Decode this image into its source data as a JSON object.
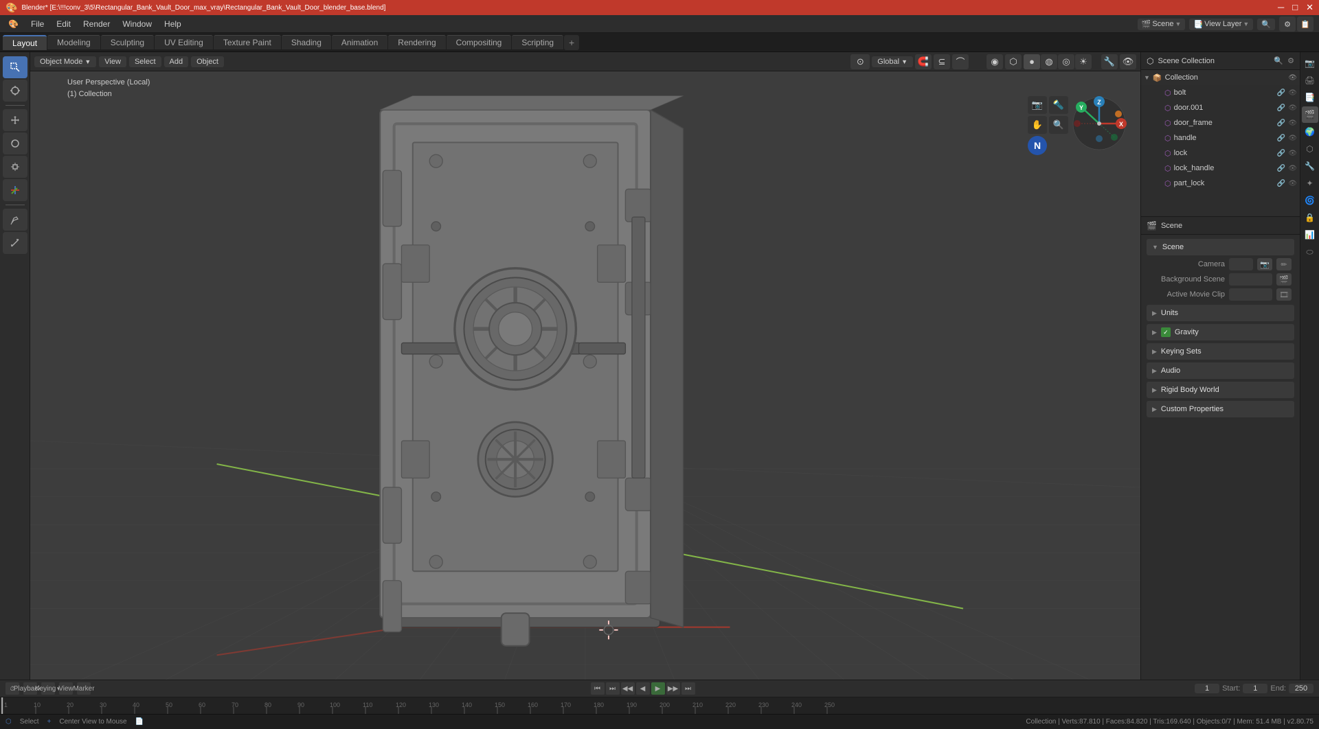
{
  "titleBar": {
    "title": "Blender* [E:\\!!!conv_3\\5\\Rectangular_Bank_Vault_Door_max_vray\\Rectangular_Bank_Vault_Door_blender_base.blend]",
    "close": "✕",
    "minimize": "─",
    "maximize": "□"
  },
  "menuBar": {
    "items": [
      "Blender",
      "File",
      "Edit",
      "Render",
      "Window",
      "Help"
    ]
  },
  "workspaceTabs": {
    "tabs": [
      "Layout",
      "Modeling",
      "Sculpting",
      "UV Editing",
      "Texture Paint",
      "Shading",
      "Animation",
      "Rendering",
      "Compositing",
      "Scripting"
    ],
    "activeTab": "Layout",
    "addLabel": "+"
  },
  "viewport": {
    "modeLabel": "Object Mode",
    "viewLabel": "View",
    "selectLabel": "Select",
    "addLabel": "Add",
    "objectLabel": "Object",
    "globalLabel": "Global",
    "infoLine1": "User Perspective (Local)",
    "infoLine2": "(1) Collection"
  },
  "outliner": {
    "title": "Scene Collection",
    "items": [
      {
        "name": "Collection",
        "indent": 0,
        "type": "collection",
        "expanded": true
      },
      {
        "name": "bolt",
        "indent": 1,
        "type": "mesh"
      },
      {
        "name": "door.001",
        "indent": 1,
        "type": "mesh"
      },
      {
        "name": "door_frame",
        "indent": 1,
        "type": "mesh"
      },
      {
        "name": "handle",
        "indent": 1,
        "type": "mesh"
      },
      {
        "name": "lock",
        "indent": 1,
        "type": "mesh"
      },
      {
        "name": "lock_handle",
        "indent": 1,
        "type": "mesh"
      },
      {
        "name": "part_lock",
        "indent": 1,
        "type": "mesh"
      }
    ]
  },
  "propertiesPanel": {
    "activeIcon": "scene",
    "icons": [
      "scene-render",
      "output",
      "view-layer",
      "scene-icon",
      "world",
      "object",
      "modifier",
      "particles",
      "physics",
      "constraints",
      "data",
      "material",
      "shader-nodes"
    ],
    "sections": [
      {
        "name": "Scene",
        "expanded": true,
        "rows": [
          {
            "label": "Camera",
            "value": "",
            "hasBtn": true
          },
          {
            "label": "Background Scene",
            "value": "",
            "hasBtn": true
          },
          {
            "label": "Active Movie Clip",
            "value": "",
            "hasBtn": true
          }
        ]
      },
      {
        "name": "Units",
        "expanded": false,
        "rows": []
      },
      {
        "name": "Gravity",
        "expanded": false,
        "rows": [],
        "hasCheck": true
      },
      {
        "name": "Keying Sets",
        "expanded": false,
        "rows": []
      },
      {
        "name": "Audio",
        "expanded": false,
        "rows": []
      },
      {
        "name": "Rigid Body World",
        "expanded": false,
        "rows": []
      },
      {
        "name": "Custom Properties",
        "expanded": false,
        "rows": []
      }
    ]
  },
  "timeline": {
    "controlLabels": [
      "⏮",
      "⏭",
      "◀◀",
      "◀",
      "⏸",
      "▶",
      "▶▶",
      "⏭"
    ],
    "playbackLabel": "Playback",
    "keyingLabel": "Keying",
    "viewLabel": "View",
    "markerLabel": "Marker",
    "currentFrame": "1",
    "startLabel": "Start:",
    "startFrame": "1",
    "endLabel": "End:",
    "endFrame": "250",
    "rulerMarks": [
      "1",
      "10",
      "20",
      "30",
      "40",
      "50",
      "60",
      "70",
      "80",
      "90",
      "100",
      "110",
      "120",
      "130",
      "140",
      "150",
      "160",
      "170",
      "180",
      "190",
      "200",
      "210",
      "220",
      "230",
      "240",
      "250"
    ]
  },
  "statusBar": {
    "selectHint": "Select",
    "centerHint": "Center View to Mouse",
    "stats": "Collection | Verts:87.810 | Faces:84.820 | Tris:169.640 | Objects:0/7 | Mem: 51.4 MB | v2.80.75"
  },
  "topRightArea": {
    "sceneLabel": "Scene",
    "viewLayerLabel": "View Layer",
    "searchPlaceholder": "🔍"
  },
  "colors": {
    "accent": "#4772b3",
    "background": "#3d3d3d",
    "panelBg": "#2d2d2d",
    "titleBg": "#c0392b"
  }
}
